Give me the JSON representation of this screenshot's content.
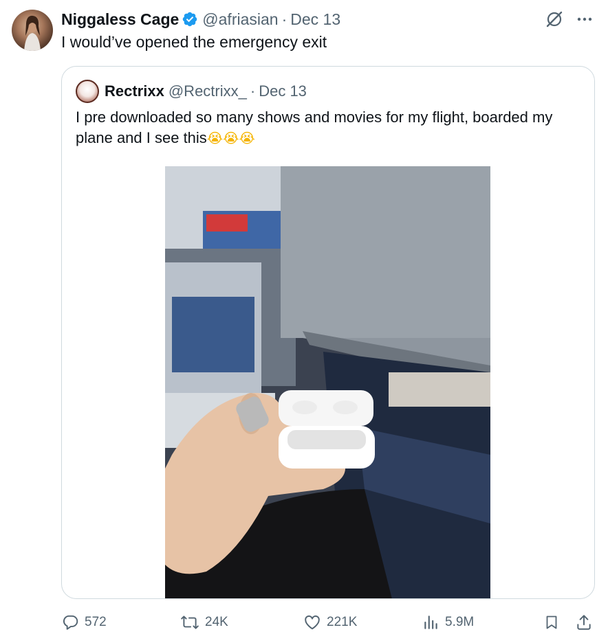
{
  "tweet": {
    "author_name": "Niggaless Cage",
    "author_handle": "@afriasian",
    "separator": "·",
    "date": "Dec 13",
    "text": "I would’ve opened the emergency exit"
  },
  "quote": {
    "author_name": "Rectrixx",
    "author_handle": "@Rectrixx_",
    "separator": "·",
    "date": "Dec 13",
    "text": "I pre downloaded so many shows and movies for my flight, boarded my plane and I see this",
    "emojis": "😭😭😭"
  },
  "actions": {
    "replies": "572",
    "reposts": "24K",
    "likes": "221K",
    "views": "5.9M"
  },
  "icons": {
    "verified": "verified-badge-icon",
    "grok": "grok-icon",
    "more": "more-icon",
    "reply": "reply-icon",
    "repost": "repost-icon",
    "like": "heart-icon",
    "views": "views-icon",
    "bookmark": "bookmark-icon",
    "share": "share-icon"
  },
  "colors": {
    "verified": "#1d9bf0",
    "secondary_text": "#536471",
    "border": "#cfd9de"
  }
}
